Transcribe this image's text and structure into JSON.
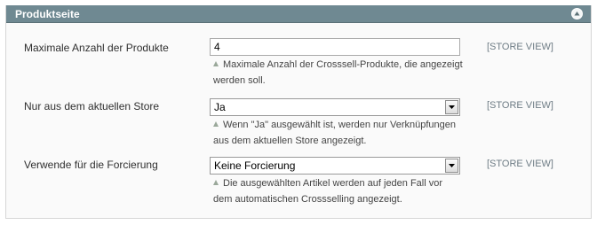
{
  "section": {
    "title": "Produktseite"
  },
  "fields": [
    {
      "label": "Maximale Anzahl der Produkte",
      "value": "4",
      "note_line1": "Maximale Anzahl der Crosssell-Produkte, die angezeigt",
      "note_line2": "werden soll.",
      "scope": "[STORE VIEW]"
    },
    {
      "label": "Nur aus dem aktuellen Store",
      "value": "Ja",
      "note_line1": "Wenn \"Ja\" ausgewählt ist, werden nur Verknüpfungen",
      "note_line2": "aus dem aktuellen Store angezeigt.",
      "scope": "[STORE VIEW]"
    },
    {
      "label": "Verwende für die Forcierung",
      "value": "Keine Forcierung",
      "note_line1": "Die ausgewählten Artikel werden auf jeden Fall vor",
      "note_line2": "dem automatischen Crossselling angezeigt.",
      "scope": "[STORE VIEW]"
    }
  ],
  "colors": {
    "header_bg": "#6f8992",
    "scope_text": "#6e7c85"
  },
  "icons": {
    "collapse": "collapse-arrow-up-icon",
    "note": "note-triangle-icon",
    "dropdown": "chevron-down-icon"
  }
}
